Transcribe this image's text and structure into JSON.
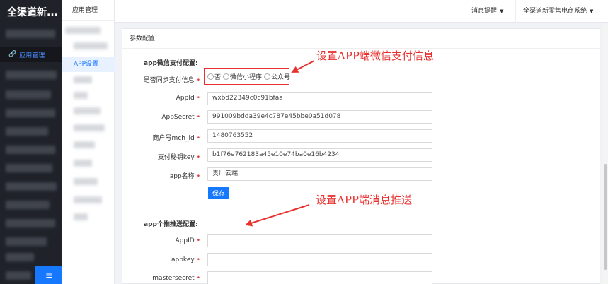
{
  "sidebar": {
    "brand": "全渠道新...",
    "active_item": "应用管理",
    "toggle_icon": "≡"
  },
  "submenu": {
    "title": "应用管理",
    "active_item": "APP设置"
  },
  "header": {
    "notifications": "消息提醒",
    "system": "全渠道新零售电商系统"
  },
  "panel": {
    "title": "参数配置"
  },
  "wechat_pay": {
    "section_title": "app微信支付配置:",
    "sync_label": "是否同步支付信息",
    "sync_options": [
      "否",
      "微信小程序",
      "公众号"
    ],
    "fields": [
      {
        "label": "AppId",
        "value": "wxbd22349c0c91bfaa"
      },
      {
        "label": "AppSecret",
        "value": "991009bdda39e4c787e45bbe0a51d078"
      },
      {
        "label": "商户号mch_id",
        "value": "1480763552"
      },
      {
        "label": "支付秘钥key",
        "value": "b1f76e762183a45e10e74ba0e16b4234"
      },
      {
        "label": "app名称",
        "value": "贵川云端"
      }
    ],
    "save_label": "保存"
  },
  "push": {
    "section_title": "app个推推送配置:",
    "fields": [
      {
        "label": "AppID",
        "value": ""
      },
      {
        "label": "appkey",
        "value": ""
      },
      {
        "label": "mastersecret",
        "value": ""
      }
    ]
  },
  "annotations": {
    "wechat": "设置APP端微信支付信息",
    "push": "设置APP端消息推送"
  },
  "colors": {
    "accent": "#1677ff",
    "annotation": "#e8322f",
    "sidebar_bg": "#1f2229"
  }
}
